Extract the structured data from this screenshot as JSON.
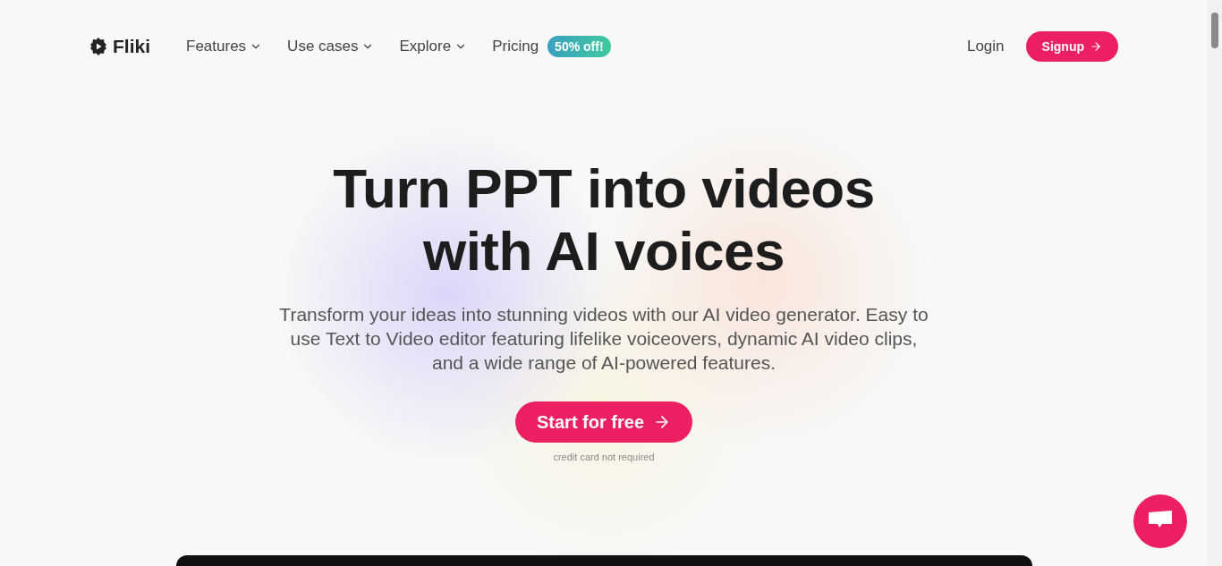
{
  "brand": {
    "name": "Fliki"
  },
  "nav": [
    {
      "label": "Features",
      "dropdown": true
    },
    {
      "label": "Use cases",
      "dropdown": true
    },
    {
      "label": "Explore",
      "dropdown": true
    },
    {
      "label": "Pricing",
      "dropdown": false,
      "badge": "50% off!"
    }
  ],
  "login": "Login",
  "signup": "Signup",
  "hero": {
    "title_lines": [
      "Turn PPT into videos",
      "with AI voices"
    ],
    "subtitle": "Transform your ideas into stunning videos with our AI video generator. Easy to use Text to Video editor featuring lifelike voiceovers, dynamic AI video clips, and a wide range of AI-powered features.",
    "cta": "Start for free",
    "note": "credit card not required"
  }
}
